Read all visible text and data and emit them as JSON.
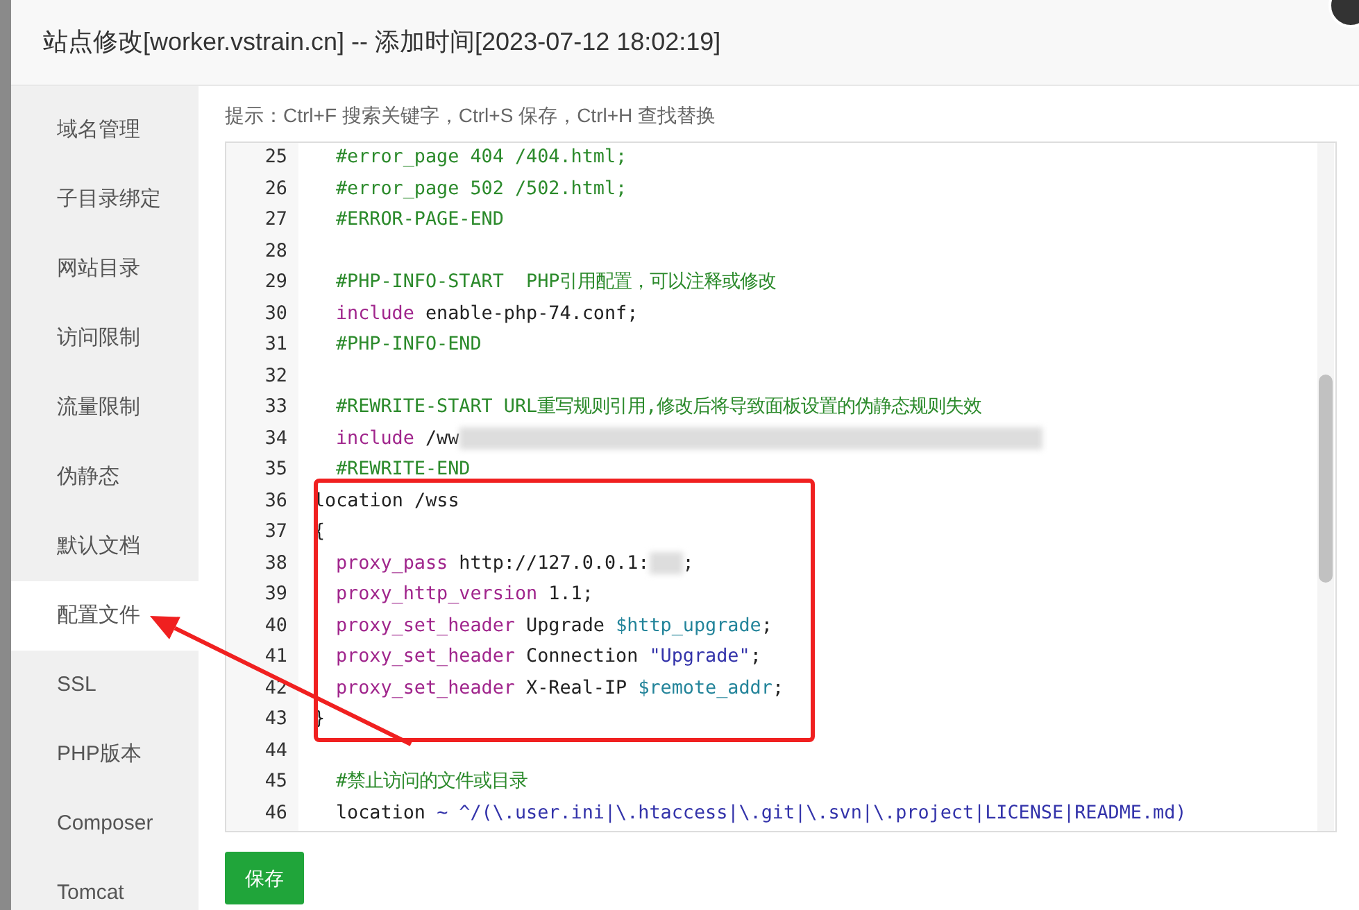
{
  "dialog": {
    "title": "站点修改[worker.vstrain.cn] -- 添加时间[2023-07-12 18:02:19]"
  },
  "sidebar": {
    "items": [
      {
        "label": "域名管理",
        "selected": false
      },
      {
        "label": "子目录绑定",
        "selected": false
      },
      {
        "label": "网站目录",
        "selected": false
      },
      {
        "label": "访问限制",
        "selected": false
      },
      {
        "label": "流量限制",
        "selected": false
      },
      {
        "label": "伪静态",
        "selected": false
      },
      {
        "label": "默认文档",
        "selected": false
      },
      {
        "label": "配置文件",
        "selected": true
      },
      {
        "label": "SSL",
        "selected": false
      },
      {
        "label": "PHP版本",
        "selected": false
      },
      {
        "label": "Composer",
        "selected": false
      },
      {
        "label": "Tomcat",
        "selected": false
      }
    ]
  },
  "hint": "提示：Ctrl+F 搜索关键字，Ctrl+S 保存，Ctrl+H 查找替换",
  "editor": {
    "blocks": [
      {
        "highlighted": false,
        "lines": [
          {
            "number": "25",
            "tokens": [
              {
                "kind": "comment",
                "text": "#error_page 404 /404.html;"
              }
            ]
          },
          {
            "number": "26",
            "tokens": [
              {
                "kind": "comment",
                "text": "#error_page 502 /502.html;"
              }
            ]
          },
          {
            "number": "27",
            "tokens": [
              {
                "kind": "comment",
                "text": "#ERROR-PAGE-END"
              }
            ]
          },
          {
            "number": "28"
          },
          {
            "number": "29",
            "tokens": [
              {
                "kind": "comment",
                "text": "#PHP-INFO-START  PHP引用配置，可以注释或修改"
              }
            ]
          },
          {
            "number": "30",
            "tokens": [
              {
                "kind": "keyword",
                "text": "include"
              },
              {
                "kind": "plain",
                "text": " enable-php-74.conf;"
              }
            ]
          },
          {
            "number": "31",
            "tokens": [
              {
                "kind": "comment",
                "text": "#PHP-INFO-END"
              }
            ]
          },
          {
            "number": "32"
          },
          {
            "number": "33",
            "tokens": [
              {
                "kind": "comment",
                "text": "#REWRITE-START URL重写规则引用,修改后将导致面板设置的伪静态规则失效"
              }
            ]
          },
          {
            "number": "34",
            "tokens": [
              {
                "kind": "keyword",
                "text": "include"
              },
              {
                "kind": "plain",
                "text": " /ww"
              },
              {
                "kind": "redacted"
              }
            ]
          },
          {
            "number": "35",
            "tokens": [
              {
                "kind": "comment",
                "text": "#REWRITE-END"
              }
            ]
          }
        ]
      },
      {
        "highlighted": true,
        "lines": [
          {
            "number": "36",
            "tokens": [
              {
                "kind": "plain",
                "text": "location /wss"
              }
            ]
          },
          {
            "number": "37",
            "tokens": [
              {
                "kind": "plain",
                "text": "{"
              }
            ],
            "children": [
              {
                "number": "38",
                "tokens": [
                  {
                    "kind": "keyword",
                    "text": "proxy_pass"
                  },
                  {
                    "kind": "plain",
                    "text": " http://127.0.0.1:"
                  },
                  {
                    "kind": "redacted"
                  },
                  {
                    "kind": "plain",
                    "text": ";"
                  }
                ]
              },
              {
                "number": "39",
                "tokens": [
                  {
                    "kind": "keyword",
                    "text": "proxy_http_version"
                  },
                  {
                    "kind": "plain",
                    "text": " 1.1;"
                  }
                ]
              },
              {
                "number": "40",
                "tokens": [
                  {
                    "kind": "keyword",
                    "text": "proxy_set_header"
                  },
                  {
                    "kind": "plain",
                    "text": " Upgrade "
                  },
                  {
                    "kind": "variable",
                    "text": "$http_upgrade"
                  },
                  {
                    "kind": "plain",
                    "text": ";"
                  }
                ]
              },
              {
                "number": "41",
                "tokens": [
                  {
                    "kind": "keyword",
                    "text": "proxy_set_header"
                  },
                  {
                    "kind": "plain",
                    "text": " Connection "
                  },
                  {
                    "kind": "string",
                    "text": "\"Upgrade\""
                  },
                  {
                    "kind": "plain",
                    "text": ";"
                  }
                ]
              },
              {
                "number": "42",
                "tokens": [
                  {
                    "kind": "keyword",
                    "text": "proxy_set_header"
                  },
                  {
                    "kind": "plain",
                    "text": " X-Real-IP "
                  },
                  {
                    "kind": "variable",
                    "text": "$remote_addr"
                  },
                  {
                    "kind": "plain",
                    "text": ";"
                  }
                ]
              }
            ]
          },
          {
            "number": "43",
            "tokens": [
              {
                "kind": "plain",
                "text": "}"
              }
            ]
          }
        ]
      },
      {
        "highlighted": false,
        "lines": [
          {
            "number": "44"
          },
          {
            "number": "45",
            "tokens": [
              {
                "kind": "comment",
                "text": "#禁止访问的文件或目录"
              }
            ]
          },
          {
            "number": "46",
            "tokens": [
              {
                "kind": "plain",
                "text": "location "
              },
              {
                "kind": "operator",
                "text": "~ ^/(\\.user.ini|\\.htaccess|\\.git|\\.svn|\\.project|LICENSE|README.md)"
              }
            ]
          }
        ]
      }
    ]
  },
  "save_button": "保存"
}
